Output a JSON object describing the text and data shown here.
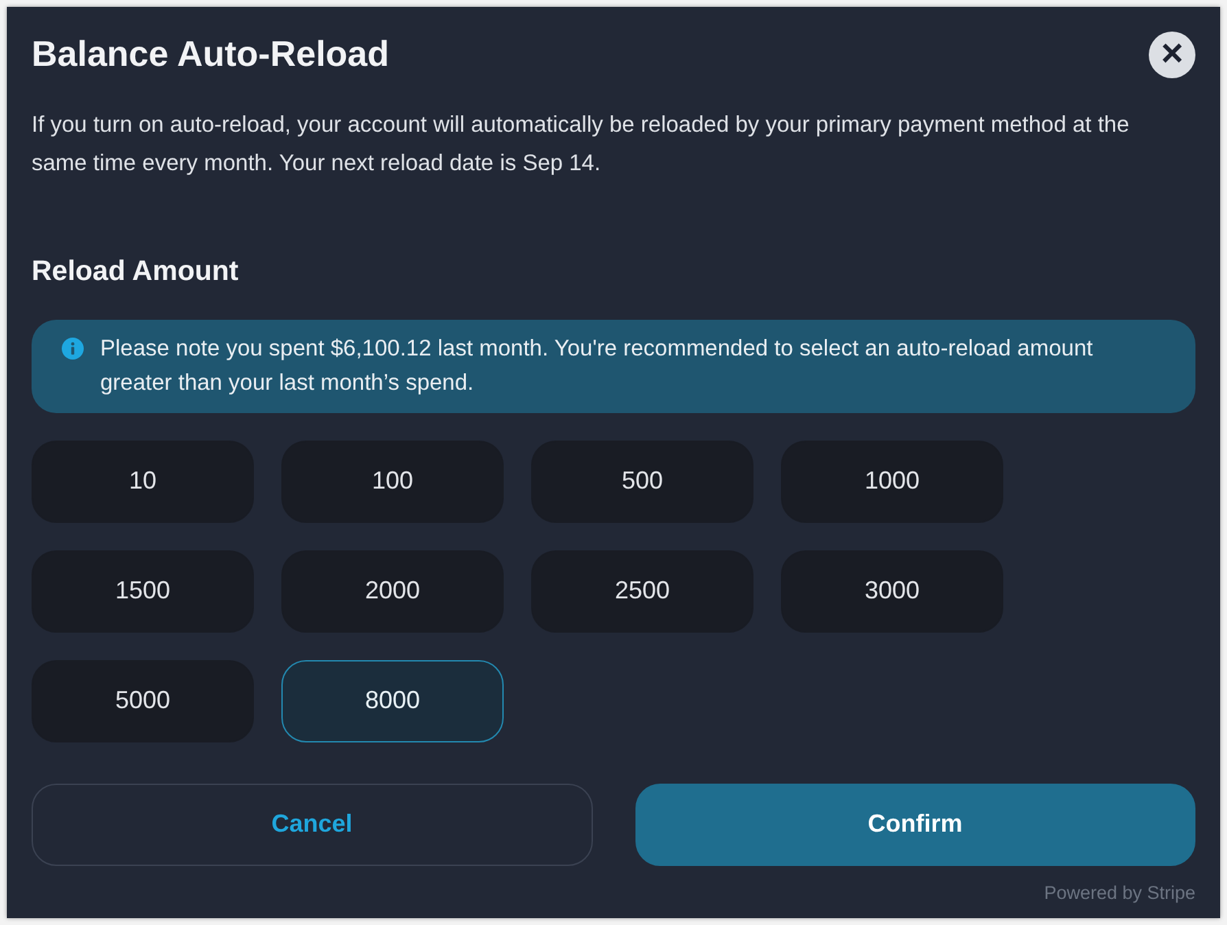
{
  "dialog": {
    "title": "Balance Auto-Reload",
    "close_button": {
      "label": "×"
    },
    "description": "If you turn on auto-reload, your account will automatically be reloaded by your primary payment method at the same time every month. Your next reload date is Sep 14."
  },
  "reload_amount": {
    "heading": "Reload Amount",
    "notice": "Please note you spent $6,100.12 last month. You're recommended to select an auto-reload amount greater than your last month’s spend.",
    "options": [
      {
        "label": "10",
        "selected": false
      },
      {
        "label": "100",
        "selected": false
      },
      {
        "label": "500",
        "selected": false
      },
      {
        "label": "1000",
        "selected": false
      },
      {
        "label": "1500",
        "selected": false
      },
      {
        "label": "2000",
        "selected": false
      },
      {
        "label": "2500",
        "selected": false
      },
      {
        "label": "3000",
        "selected": false
      },
      {
        "label": "5000",
        "selected": false
      },
      {
        "label": "8000",
        "selected": true
      }
    ]
  },
  "buttons": [
    {
      "label": "Cancel",
      "kind": "secondary"
    },
    {
      "label": "Confirm",
      "kind": "primary"
    }
  ],
  "footer": "Powered by Stripe"
}
